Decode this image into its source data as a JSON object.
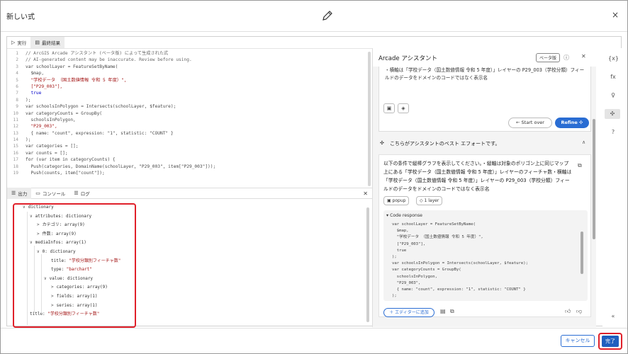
{
  "dialog": {
    "title": "新しい式",
    "close": "×"
  },
  "tabs_top": [
    {
      "icon": "▷",
      "label": "実行"
    },
    {
      "icon": "▤",
      "label": "最終結果"
    }
  ],
  "code_lines": [
    {
      "n": "1",
      "t": "// ArcGIS Arcade アシスタント (ベータ版) によって生成された式",
      "c": "cm"
    },
    {
      "n": "2",
      "t": "// AI-generated content may be inaccurate. Review before using.",
      "c": "cm"
    },
    {
      "n": "3",
      "t": "var schoolLayer = FeatureSetByName(",
      "c": "ct"
    },
    {
      "n": "4",
      "t": "  $map,",
      "c": "ct"
    },
    {
      "n": "5",
      "t": "  \"学校データ （国土数値情報 令和 5 年度）\",",
      "c": "str"
    },
    {
      "n": "6",
      "t": "  [\"P29_003\"],",
      "c": "str"
    },
    {
      "n": "7",
      "t": "  true",
      "c": "kw"
    },
    {
      "n": "8",
      "t": ");",
      "c": "ct"
    },
    {
      "n": "9",
      "t": "var schoolsInPolygon = Intersects(schoolLayer, $feature);",
      "c": "ct"
    },
    {
      "n": "10",
      "t": "var categoryCounts = GroupBy(",
      "c": "ct"
    },
    {
      "n": "11",
      "t": "  schoolsInPolygon,",
      "c": "ct"
    },
    {
      "n": "12",
      "t": "  \"P29_003\",",
      "c": "str"
    },
    {
      "n": "13",
      "t": "  { name: \"count\", expression: \"1\", statistic: \"COUNT\" }",
      "c": "ct"
    },
    {
      "n": "14",
      "t": ");",
      "c": "ct"
    },
    {
      "n": "15",
      "t": "var categories = [];",
      "c": "ct"
    },
    {
      "n": "16",
      "t": "var counts = [];",
      "c": "ct"
    },
    {
      "n": "17",
      "t": "for (var item in categoryCounts) {",
      "c": "ct"
    },
    {
      "n": "18",
      "t": "  Push(categories, DomainName(schoolLayer, \"P29_003\", item[\"P29_003\"]));",
      "c": "ct"
    },
    {
      "n": "19",
      "t": "  Push(counts, item[\"count\"]);",
      "c": "ct"
    }
  ],
  "tabs_bottom": [
    {
      "icon": "☰",
      "label": "出力"
    },
    {
      "icon": "▭",
      "label": "コンソール"
    },
    {
      "icon": "☰",
      "label": "ログ"
    }
  ],
  "output_rows": [
    {
      "chev": "∨",
      "key": "dictionary",
      "val": "",
      "indent": 0
    },
    {
      "chev": "∨",
      "key": "attributes:",
      "val": " dictionary",
      "indent": 1
    },
    {
      "chev": ">",
      "key": "カテゴリ:",
      "val": " array(9)",
      "indent": 2
    },
    {
      "chev": ">",
      "key": "件数:",
      "val": " array(9)",
      "indent": 2
    },
    {
      "chev": "∨",
      "key": "mediaInfos:",
      "val": " array(1)",
      "indent": 1
    },
    {
      "chev": "∨",
      "key": "0:",
      "val": " dictionary",
      "indent": 2
    },
    {
      "chev": "",
      "key": "title:",
      "val": " \"学校分類別フィーチャ数\"",
      "indent": 4,
      "str": true
    },
    {
      "chev": "",
      "key": "type:",
      "val": " \"barchart\"",
      "indent": 4,
      "str": true
    },
    {
      "chev": "∨",
      "key": "value:",
      "val": " dictionary",
      "indent": 3
    },
    {
      "chev": ">",
      "key": "categories:",
      "val": " array(9)",
      "indent": 4
    },
    {
      "chev": ">",
      "key": "fields:",
      "val": " array(1)",
      "indent": 4
    },
    {
      "chev": ">",
      "key": "series:",
      "val": " array(1)",
      "indent": 4
    },
    {
      "chev": "",
      "key": "title:",
      "val": " \"学校分類別フィーチャ数\"",
      "indent": 1,
      "str": true
    }
  ],
  "assistant": {
    "title": "Arcade アシスタント",
    "beta": "ベータ版",
    "prompt": "・横軸は「学校データ（国土数値情報 令和 5 年度）」レイヤーの P29_003（学校分類）フィールドのデータをドメインのコードではなく表示名",
    "start_over": "Start over",
    "refine": "Refine",
    "best_effort": "こちらがアシスタントのベスト エフォートです。",
    "response": "以下の条件で縦棒グラフを表示してください。・縦軸は対象のポリゴン上に同じマップ上にある「学校データ（国土数値情報 令和 5 年度）」レイヤーのフィーチャ数・横軸は「学校データ（国土数値情報 令和 5 年度）」レイヤーの P29_003（学校分類）フィールドのデータをドメインのコードではなく表示名",
    "chip_popup": "popup",
    "chip_layer": "1 layer",
    "code_response_label": "▾ Code response",
    "code_response": [
      "var schoolLayer = FeatureSetByName(",
      "  $map,",
      "  \"学校データ （国土数値情報 令和 5 年度）\",",
      "  [\"P29_003\"],",
      "  true",
      ");",
      "var schoolsInPolygon = Intersects(schoolLayer, $feature);",
      "var categoryCounts = GroupBy(",
      "  schoolsInPolygon,",
      "  \"P29_003\",",
      "  { name: \"count\", expression: \"1\", statistic: \"COUNT\" }",
      ");"
    ],
    "add_to_editor": "＋ エディターに追加"
  },
  "rail": [
    "{x}",
    "fx",
    "♀",
    "✣",
    "?",
    "«"
  ],
  "footer": {
    "cancel": "キャンセル",
    "done": "完了"
  }
}
